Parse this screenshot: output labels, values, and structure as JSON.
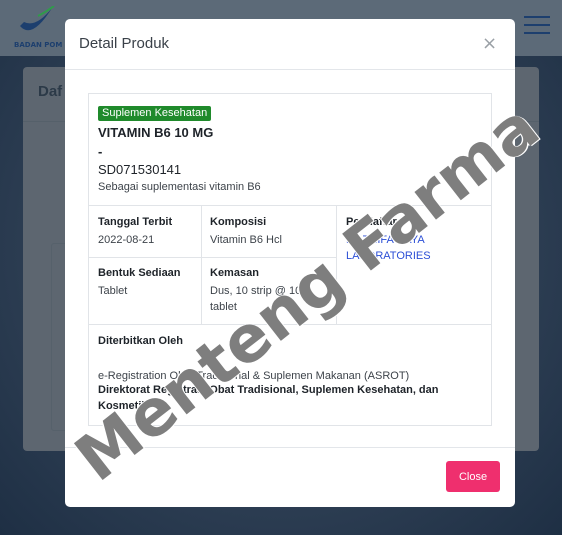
{
  "background": {
    "logo_text": "BADAN POM",
    "card_title": "Daf"
  },
  "modal": {
    "title": "Detail Produk",
    "close_symbol": "×",
    "badge": "Suplemen Kesehatan",
    "product_name": "VITAMIN B6 10 MG",
    "dash": "-",
    "registration_code": "SD071530141",
    "description": "Sebagai suplementasi vitamin B6",
    "fields": {
      "tanggal_terbit_label": "Tanggal Terbit",
      "tanggal_terbit_value": "2022-08-21",
      "komposisi_label": "Komposisi",
      "komposisi_value": "Vitamin B6 Hcl",
      "pendaftar_label": "Pendaftar",
      "pendaftar_value_line1": "PT TRIFA RAYA",
      "pendaftar_value_line2": "LABORATORIES",
      "bentuk_sediaan_label": "Bentuk Sediaan",
      "bentuk_sediaan_value": "Tablet",
      "kemasan_label": "Kemasan",
      "kemasan_value_line1": "Dus, 10 strip @ 10",
      "kemasan_value_line2": "tablet",
      "diterbitkan_label": "Diterbitkan Oleh",
      "diterbitkan_value": "e-Registration Obat Tradisional & Suplemen Makanan (ASROT)",
      "direktorat_line1": "Direktorat Registrasi Obat Tradisional, Suplemen Kesehatan, dan",
      "direktorat_line2": "Kosmetik"
    },
    "close_button_label": "Close"
  },
  "watermark": "Menteng Farma",
  "colors": {
    "badge": "#1f8a2b",
    "link": "#2b4ed6",
    "close_button": "#ef2f6e"
  }
}
